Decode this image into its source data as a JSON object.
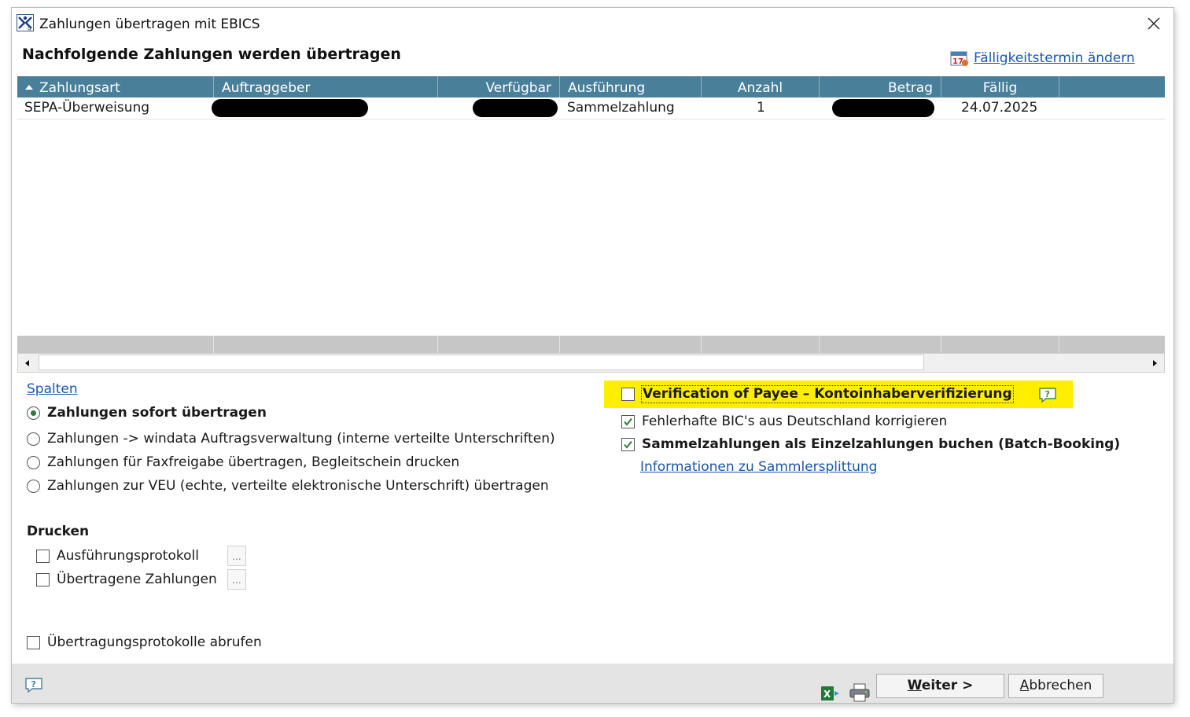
{
  "window": {
    "title": "Zahlungen übertragen mit EBICS",
    "heading": "Nachfolgende Zahlungen werden übertragen",
    "due_date_link": "Fälligkeitstermin ändern"
  },
  "table": {
    "columns": [
      "Zahlungsart",
      "Auftraggeber",
      "Verfügbar",
      "Ausführung",
      "Anzahl",
      "Betrag",
      "Fällig"
    ],
    "sorted_by": "Zahlungsart",
    "rows": [
      {
        "zahlungsart": "SEPA-Überweisung",
        "auftraggeber": "",
        "verfuegbar": "",
        "ausfuehrung": "Sammelzahlung",
        "anzahl": "1",
        "betrag": "",
        "faellig": "24.07.2025",
        "redacted": [
          "auftraggeber",
          "verfuegbar",
          "betrag"
        ]
      }
    ]
  },
  "left_panel": {
    "spalten_link": "Spalten",
    "transfer_options": [
      {
        "label": "Zahlungen sofort übertragen",
        "selected": true
      },
      {
        "label": "Zahlungen -> windata Auftragsverwaltung (interne verteilte Unterschriften)",
        "selected": false
      },
      {
        "label": "Zahlungen für Faxfreigabe übertragen, Begleitschein drucken",
        "selected": false
      },
      {
        "label": "Zahlungen zur VEU (echte, verteilte elektronische Unterschrift) übertragen",
        "selected": false
      }
    ],
    "print_section_title": "Drucken",
    "print_options": [
      {
        "label": "Ausführungsprotokoll",
        "checked": false,
        "more_button": "..."
      },
      {
        "label": "Übertragene Zahlungen",
        "checked": false,
        "more_button": "..."
      }
    ],
    "fetch_protocols": {
      "label": "Übertragungsprotokolle abrufen",
      "checked": false
    }
  },
  "right_panel": {
    "verification_of_payee": {
      "label": "Verification of Payee – Kontoinhaberverifizierung",
      "checked": false,
      "highlight_color": "#ffee00"
    },
    "fix_bic": {
      "label": "Fehlerhafte BIC's aus Deutschland korrigieren",
      "checked": true
    },
    "batch_booking": {
      "label": "Sammelzahlungen als Einzelzahlungen buchen (Batch-Booking)",
      "checked": true
    },
    "info_link": "Informationen zu Sammlersplittung"
  },
  "footer": {
    "next_button": {
      "accel": "W",
      "rest": "eiter >"
    },
    "cancel_button": {
      "accel": "A",
      "rest": "bbrechen"
    }
  },
  "colors": {
    "header_bg": "#4a7f9a",
    "link": "#1a56b0",
    "highlight": "#ffee00",
    "check": "#2f7a3c"
  }
}
